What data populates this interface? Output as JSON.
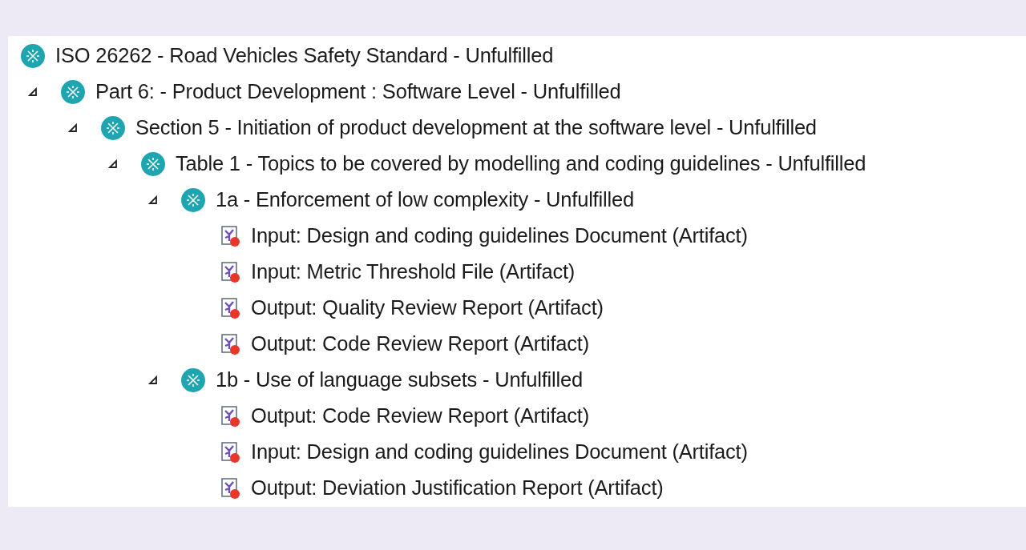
{
  "tree": [
    {
      "kind": "requirement",
      "label": "ISO 26262 - Road Vehicles Safety Standard - Unfulfilled",
      "children": [
        {
          "kind": "requirement",
          "label": "Part 6: - Product Development : Software Level - Unfulfilled",
          "expanded": true,
          "children": [
            {
              "kind": "requirement",
              "label": "Section 5 - Initiation of product development at the software level - Unfulfilled",
              "expanded": true,
              "children": [
                {
                  "kind": "requirement",
                  "label": "Table 1 - Topics to be covered by modelling and coding guidelines - Unfulfilled",
                  "expanded": true,
                  "children": [
                    {
                      "kind": "requirement",
                      "label": "1a - Enforcement of low complexity - Unfulfilled",
                      "expanded": true,
                      "children": [
                        {
                          "kind": "artifact",
                          "label": "Input: Design and coding guidelines Document (Artifact)"
                        },
                        {
                          "kind": "artifact",
                          "label": "Input: Metric Threshold File (Artifact)"
                        },
                        {
                          "kind": "artifact",
                          "label": "Output: Quality Review Report (Artifact)"
                        },
                        {
                          "kind": "artifact",
                          "label": "Output: Code Review Report (Artifact)"
                        }
                      ]
                    },
                    {
                      "kind": "requirement",
                      "label": "1b - Use of language subsets - Unfulfilled",
                      "expanded": true,
                      "children": [
                        {
                          "kind": "artifact",
                          "label": "Output: Code Review Report (Artifact)"
                        },
                        {
                          "kind": "artifact",
                          "label": "Input: Design and coding guidelines Document (Artifact)"
                        },
                        {
                          "kind": "artifact",
                          "label": "Output: Deviation Justification Report (Artifact)"
                        }
                      ]
                    }
                  ]
                }
              ]
            }
          ]
        }
      ]
    }
  ]
}
